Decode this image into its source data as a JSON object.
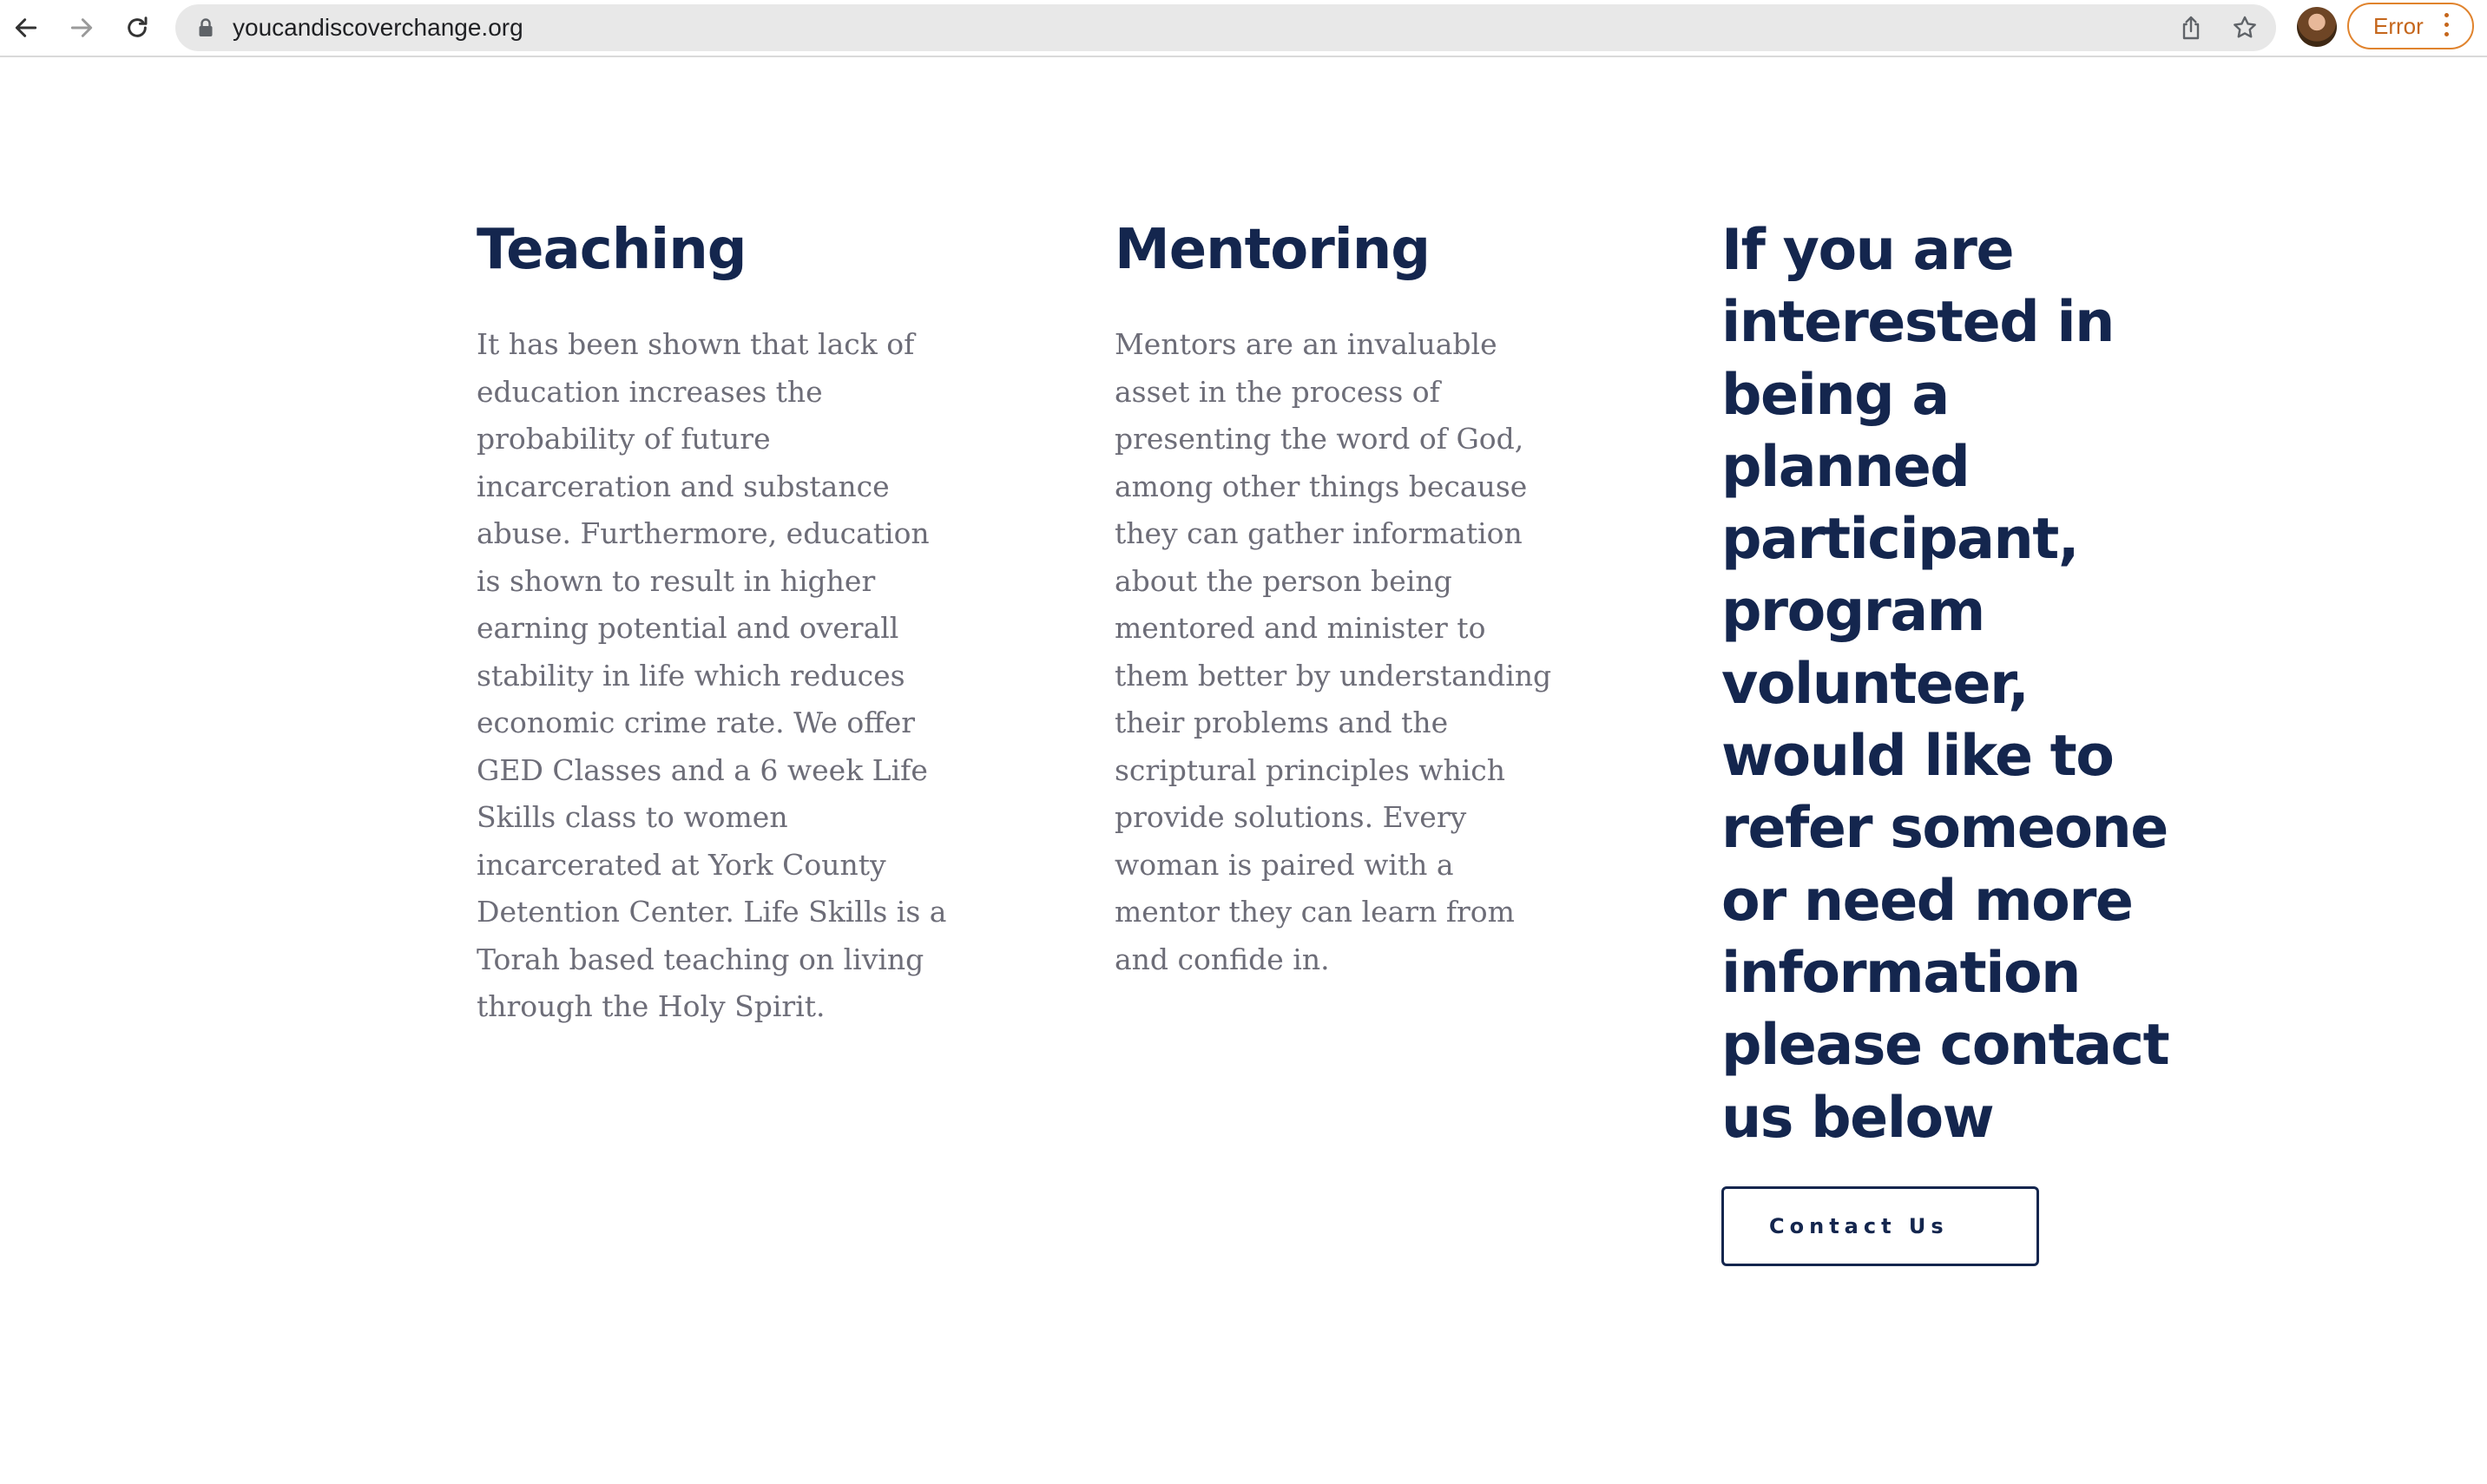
{
  "browser": {
    "url": "youcandiscoverchange.org",
    "status_label": "Error",
    "icons": [
      "back-arrow-icon",
      "forward-arrow-icon",
      "reload-icon",
      "lock-icon",
      "share-icon",
      "bookmark-star-icon",
      "profile-avatar",
      "kebab-menu-icon"
    ]
  },
  "colors": {
    "heading": "#14264e",
    "body_text": "#6d6d78",
    "error_accent": "#e0832d"
  },
  "columns": [
    {
      "title": "Teaching",
      "body": "It has been shown that lack of\neducation increases the\nprobability of future\nincarceration and substance\nabuse. Furthermore, education\nis shown to result in higher\nearning potential and overall\nstability in life which reduces\neconomic crime rate. We offer\nGED Classes and a 6 week Life\nSkills class to women\nincarcerated at York County\nDetention Center. Life Skills is a\nTorah based teaching on living\nthrough the Holy Spirit."
    },
    {
      "title": "Mentoring",
      "body": "Mentors are an invaluable\nasset in the process of\npresenting the word of God,\namong other things because\nthey can gather information\nabout the person being\nmentored and minister to\nthem better by understanding\ntheir problems and the\nscriptural principles which\nprovide solutions. Every\nwoman is paired with a\nmentor  they can learn from\nand confide in."
    }
  ],
  "cta": {
    "heading": "If you are\ninterested in\nbeing a\nplanned\nparticipant,\nprogram\nvolunteer,\nwould like to\nrefer someone\nor need more\ninformation\nplease contact\nus below",
    "button_label": "Contact Us"
  }
}
